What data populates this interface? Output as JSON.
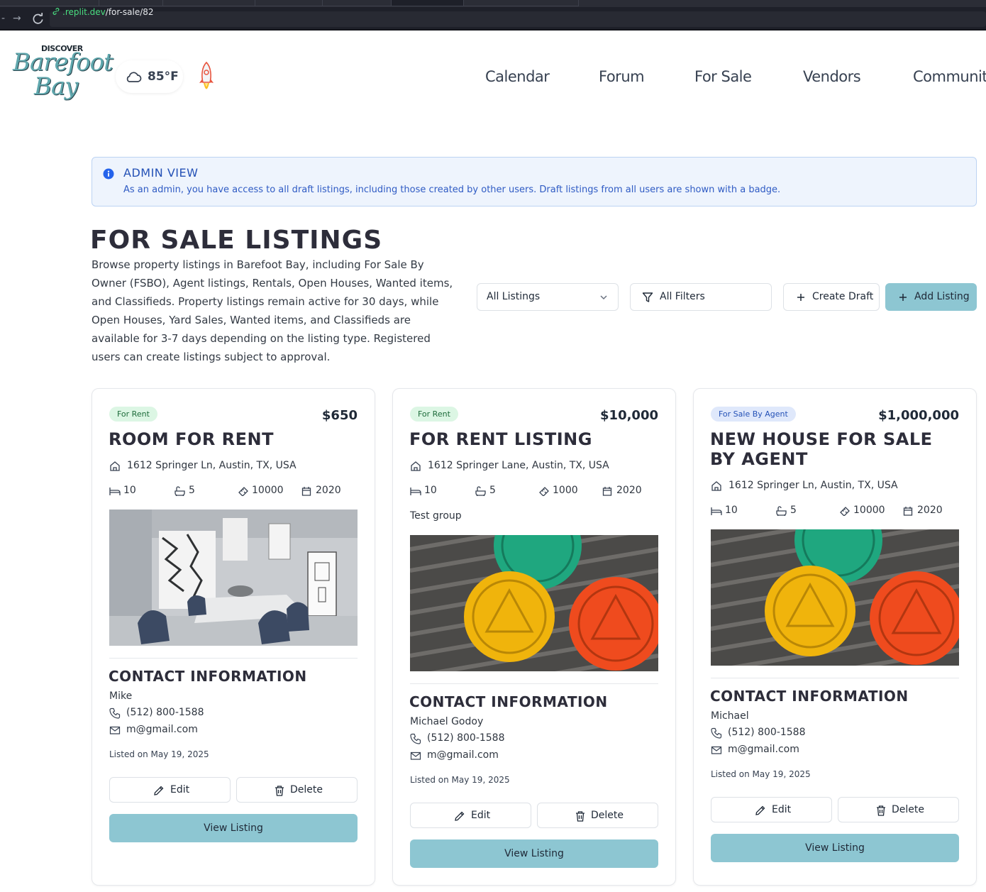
{
  "browser": {
    "url_domain": ".replit.dev",
    "url_path": "/for-sale/82"
  },
  "header": {
    "logo_small": "DISCOVER",
    "logo_line1": "Barefoot",
    "logo_line2": "Bay",
    "weather_temp": "85°F",
    "weather_icon": "cloud-icon",
    "nav": [
      "Calendar",
      "Forum",
      "For Sale",
      "Vendors",
      "Community"
    ]
  },
  "admin": {
    "title": "ADMIN VIEW",
    "text": "As an admin, you have access to all draft listings, including those created by other users. Draft listings from all users are shown with a badge."
  },
  "page": {
    "title": "FOR SALE LISTINGS",
    "description": "Browse property listings in Barefoot Bay, including For Sale By Owner (FSBO), Agent listings, Rentals, Open Houses, Wanted items, and Classifieds. Property listings remain active for 30 days, while Open Houses, Yard Sales, Wanted items, and Classifieds are available for 3-7 days depending on the listing type. Registered users can create listings subject to approval."
  },
  "controls": {
    "filter_select": "All Listings",
    "all_filters": "All Filters",
    "create_draft": "Create Draft",
    "add_listing": "Add Listing"
  },
  "colors": {
    "accent": "#8dc6d2",
    "admin_bg": "#eef4fd",
    "admin_text": "#2451b6",
    "badge_rent_bg": "#dcf6e4",
    "badge_agent_bg": "#dfe8fb"
  },
  "labels": {
    "contact_heading": "CONTACT INFORMATION",
    "edit": "Edit",
    "delete": "Delete",
    "view": "View Listing"
  },
  "listings": [
    {
      "badge": "For Rent",
      "price": "$650",
      "title": "ROOM FOR RENT",
      "address": "1612 Springer Ln, Austin, TX, USA",
      "beds": "10",
      "baths": "5",
      "sqft": "10000",
      "year": "2020",
      "group": "",
      "photo": "dining-room-photo",
      "contact_name": "Mike",
      "phone": "(512) 800-1588",
      "email": "m@gmail.com",
      "listed": "Listed on May 19, 2025"
    },
    {
      "badge": "For Rent",
      "price": "$10,000",
      "title": "FOR RENT LISTING",
      "address": "1612 Springer Lane, Austin, TX, USA",
      "beds": "10",
      "baths": "5",
      "sqft": "1000",
      "year": "2020",
      "group": "Test group",
      "photo": "recovery-coins-photo",
      "contact_name": "Michael Godoy",
      "phone": "(512) 800-1588",
      "email": "m@gmail.com",
      "listed": "Listed on May 19, 2025"
    },
    {
      "badge": "For Sale By Agent",
      "price": "$1,000,000",
      "title": "NEW HOUSE FOR SALE BY AGENT",
      "address": "1612 Springer Ln, Austin, TX, USA",
      "beds": "10",
      "baths": "5",
      "sqft": "10000",
      "year": "2020",
      "group": "",
      "photo": "recovery-coins-photo",
      "contact_name": "Michael",
      "phone": "(512) 800-1588",
      "email": "m@gmail.com",
      "listed": "Listed on May 19, 2025"
    }
  ]
}
